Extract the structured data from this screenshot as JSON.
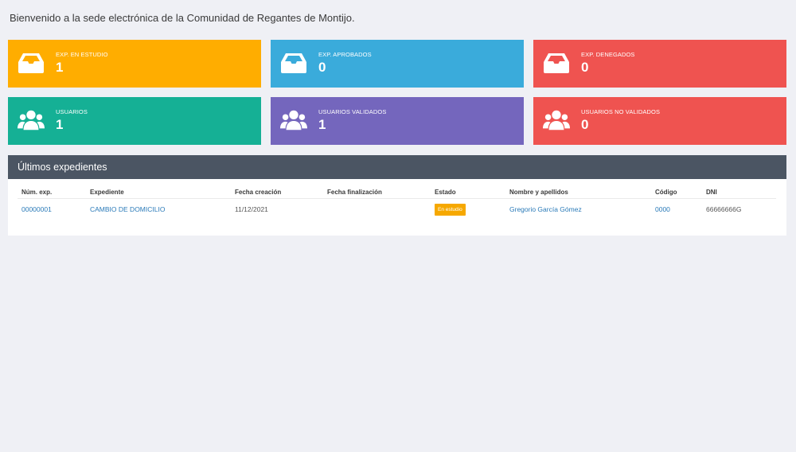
{
  "welcome": "Bienvenido a la sede electrónica de la Comunidad de Regantes de Montijo.",
  "cards": [
    {
      "label": "EXP. EN ESTUDIO",
      "count": "1",
      "color": "#ffad00",
      "icon": "inbox-icon"
    },
    {
      "label": "EXP. APROBADOS",
      "count": "0",
      "color": "#3aabdb",
      "icon": "inbox-icon"
    },
    {
      "label": "EXP. DENEGADOS",
      "count": "0",
      "color": "#ef5350",
      "icon": "inbox-icon"
    },
    {
      "label": "USUARIOS",
      "count": "1",
      "color": "#15b095",
      "icon": "users-icon"
    },
    {
      "label": "USUARIOS VALIDADOS",
      "count": "1",
      "color": "#7466bd",
      "icon": "users-icon"
    },
    {
      "label": "USUARIOS NO VALIDADOS",
      "count": "0",
      "color": "#ef5350",
      "icon": "users-icon"
    }
  ],
  "panel": {
    "title": "Últimos expedientes",
    "columns": [
      "Núm. exp.",
      "Expediente",
      "Fecha creación",
      "Fecha finalización",
      "Estado",
      "Nombre y apellidos",
      "Código",
      "DNI"
    ],
    "rows": [
      {
        "num": "00000001",
        "expediente": "CAMBIO DE DOMICILIO",
        "fecha_creacion": "11/12/2021",
        "fecha_finalizacion": "",
        "estado": "En estudio",
        "nombre": "Gregorio García Gómez",
        "codigo": "0000",
        "dni": "66666666G"
      }
    ]
  }
}
